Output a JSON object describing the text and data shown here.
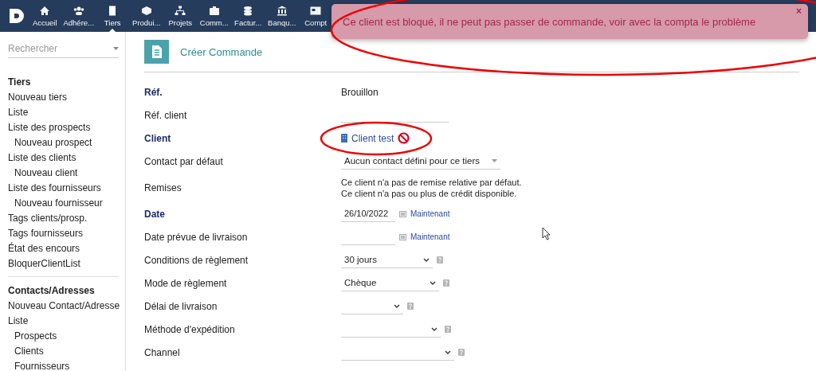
{
  "topbar": {
    "nav": [
      {
        "label": "Accueil",
        "selected": false
      },
      {
        "label": "Adhére...",
        "selected": false
      },
      {
        "label": "Tiers",
        "selected": true
      },
      {
        "label": "Produi...",
        "selected": false
      },
      {
        "label": "Projets",
        "selected": false
      },
      {
        "label": "Comm...",
        "selected": false
      },
      {
        "label": "Factur...",
        "selected": false
      },
      {
        "label": "Banqu...",
        "selected": false
      },
      {
        "label": "Compt",
        "selected": false
      }
    ]
  },
  "sidebar": {
    "search": {
      "placeholder": "Rechercher"
    },
    "sections": [
      {
        "title": "Tiers",
        "items": [
          {
            "label": "Nouveau tiers"
          },
          {
            "label": "Liste"
          },
          {
            "label": "Liste des prospects",
            "children": [
              {
                "label": "Nouveau prospect"
              }
            ]
          },
          {
            "label": "Liste des clients",
            "children": [
              {
                "label": "Nouveau client"
              }
            ]
          },
          {
            "label": "Liste des fournisseurs",
            "children": [
              {
                "label": "Nouveau fournisseur"
              }
            ]
          },
          {
            "label": "Tags clients/prosp."
          },
          {
            "label": "Tags fournisseurs"
          },
          {
            "label": "État des encours"
          },
          {
            "label": "BloquerClientList"
          }
        ]
      },
      {
        "title": "Contacts/Adresses",
        "items": [
          {
            "label": "Nouveau Contact/Adresse"
          },
          {
            "label": "Liste",
            "children": [
              {
                "label": "Prospects"
              },
              {
                "label": "Clients"
              },
              {
                "label": "Fournisseurs"
              }
            ]
          }
        ]
      }
    ]
  },
  "page": {
    "title": "Créer Commande",
    "rows": [
      {
        "label": "Réf.",
        "required": true,
        "kind": "text",
        "value": "Brouillon"
      },
      {
        "label": "Réf. client",
        "required": false,
        "kind": "input"
      },
      {
        "label": "Client",
        "required": true,
        "kind": "client",
        "value": "Client test",
        "blocked": true
      },
      {
        "label": "Contact par défaut",
        "required": false,
        "kind": "combo",
        "value": "Aucun contact défini pour ce tiers"
      },
      {
        "label": "Remises",
        "required": false,
        "kind": "info",
        "lines": [
          "Ce client n'a pas de remise relative par défaut.",
          "Ce client n'a pas ou plus de crédit disponible."
        ]
      },
      {
        "label": "Date",
        "required": true,
        "kind": "date",
        "value": "26/10/2022",
        "link": "Maintenant"
      },
      {
        "label": "Date prévue de livraison",
        "required": false,
        "kind": "date",
        "link": "Maintenant"
      },
      {
        "label": "Conditions de règlement",
        "required": false,
        "kind": "select",
        "value": "30 jours"
      },
      {
        "label": "Mode de règlement",
        "required": false,
        "kind": "select",
        "value": "Chèque"
      },
      {
        "label": "Délai de livraison",
        "required": false,
        "kind": "select"
      },
      {
        "label": "Méthode d'expédition",
        "required": false,
        "kind": "select"
      },
      {
        "label": "Channel",
        "required": false,
        "kind": "select"
      }
    ]
  },
  "toast": {
    "message": "Ce client est bloqué, il ne peut pas passer de commande, voir avec la compta le problème",
    "close": "×"
  }
}
